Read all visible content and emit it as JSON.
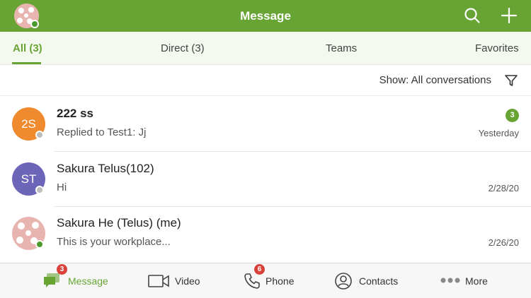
{
  "header": {
    "title": "Message"
  },
  "tabs": [
    {
      "label": "All (3)"
    },
    {
      "label": "Direct (3)"
    },
    {
      "label": "Teams"
    },
    {
      "label": "Favorites"
    }
  ],
  "filter": {
    "label": "Show: All conversations"
  },
  "conversations": [
    {
      "initials": "2S",
      "name": "222 ss",
      "preview": "Replied to Test1: Jj",
      "date": "Yesterday",
      "unread": "3"
    },
    {
      "initials": "ST",
      "name": "Sakura Telus(102)",
      "preview": "Hi",
      "date": "2/28/20"
    },
    {
      "initials": "",
      "name": "Sakura He (Telus) (me)",
      "preview": "This is your workplace...",
      "date": "2/26/20"
    }
  ],
  "bottom_nav": [
    {
      "label": "Message",
      "badge": "3",
      "icon": "message-icon"
    },
    {
      "label": "Video",
      "icon": "video-icon"
    },
    {
      "label": "Phone",
      "badge": "6",
      "icon": "phone-icon"
    },
    {
      "label": "Contacts",
      "icon": "contacts-icon"
    },
    {
      "label": "More",
      "icon": "more-icon"
    }
  ],
  "colors": {
    "brand": "#68a433",
    "avatar_orange": "#ef8a2e",
    "avatar_purple": "#6d66b8",
    "avatar_pink": "#e8b4b0",
    "badge_red": "#d9413b",
    "presence_online": "#4a9a2c",
    "presence_offline": "#bdbdbd"
  }
}
